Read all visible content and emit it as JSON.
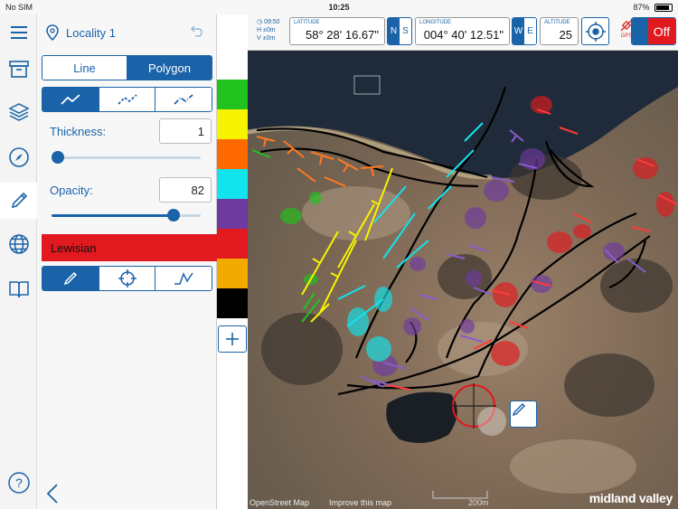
{
  "status": {
    "carrier": "No SIM",
    "time": "10:25",
    "battery": "87%"
  },
  "rail": {
    "icons": [
      "menu-icon",
      "archive-icon",
      "layers-icon",
      "compass-icon",
      "pencil-icon",
      "globe-icon",
      "book-icon",
      "help-icon"
    ],
    "active": "pencil-icon",
    "help_label": "?"
  },
  "panel": {
    "locality": "Locality 1",
    "mode_tabs": [
      {
        "label": "Line",
        "selected": false
      },
      {
        "label": "Polygon",
        "selected": true
      }
    ],
    "line_styles": [
      "solid-line-icon",
      "dashed-line-icon",
      "dotted-line-icon"
    ],
    "thickness": {
      "label": "Thickness:",
      "value": "1",
      "level": 0
    },
    "opacity": {
      "label": "Opacity:",
      "value": "82",
      "level": 0.82
    },
    "unit_name": "Lewisian",
    "draw_tools": [
      "pencil-icon",
      "crosshair-icon",
      "freehand-icon"
    ]
  },
  "swatches": [
    "#22c31e",
    "#f6f400",
    "#ff6a00",
    "#12e4ee",
    "#6f3aa0",
    "#e2191f",
    "#f2a900",
    "#000000"
  ],
  "toolbar": {
    "time": "09:50",
    "h_label": "H",
    "h_value": "±0m",
    "v_label": "V",
    "v_value": "±0m",
    "latitude_caption": "LATITUDE",
    "latitude": "58° 28' 16.67\"",
    "ns": [
      "N",
      "S"
    ],
    "longitude_caption": "LONGITUDE",
    "longitude": "004° 40' 12.51\"",
    "we": [
      "W",
      "E"
    ],
    "altitude_caption": "ALTITUDE",
    "altitude": "25",
    "gps_label": "GPS",
    "gps_toggle": "Off"
  },
  "map": {
    "attribution": "OpenStreet Map",
    "improve": "Improve this map",
    "scale": "200m",
    "brand": "midland valley"
  },
  "colors": {
    "accent": "#1a63a8",
    "danger": "#e2191f"
  }
}
